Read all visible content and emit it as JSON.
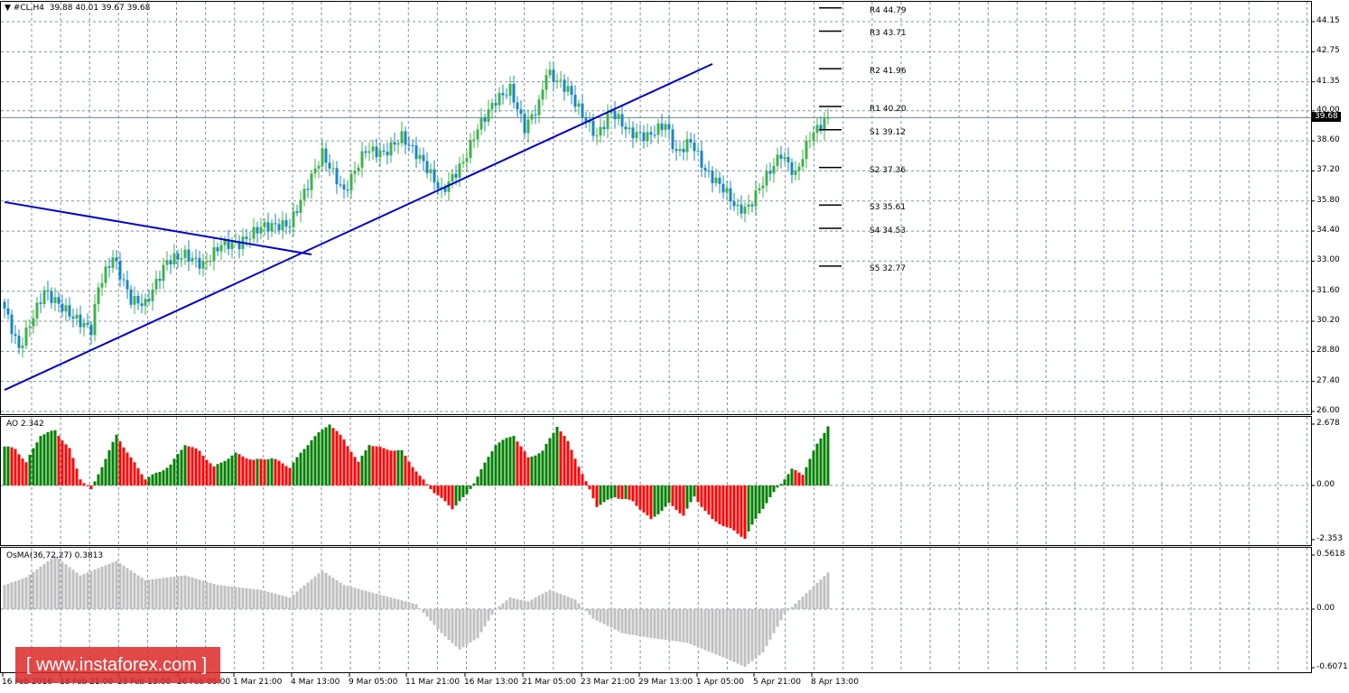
{
  "header": {
    "symbol": "#CL,H4",
    "ohlc": "39.88 40.01 39.67 39.68"
  },
  "current_price": "39.68",
  "watermark": "[ www.instaforex.com ]",
  "colors": {
    "bull": "#3fb24a",
    "bear": "#1a86c6",
    "ao_up": "#008000",
    "ao_down": "#ff0000",
    "osma": "#c0c0c0",
    "trendline": "#0000cc"
  },
  "pivots": [
    {
      "label": "R4 44.79",
      "value": 44.79
    },
    {
      "label": "R3 43.71",
      "value": 43.71
    },
    {
      "label": "R2 41.96",
      "value": 41.96
    },
    {
      "label": "R1 40.20",
      "value": 40.2
    },
    {
      "label": "S1 39.12",
      "value": 39.12
    },
    {
      "label": "S2 37.36",
      "value": 37.36
    },
    {
      "label": "S3 35.61",
      "value": 35.61
    },
    {
      "label": "S4 34.53",
      "value": 34.53
    },
    {
      "label": "S5 32.77",
      "value": 32.77
    }
  ],
  "chart_data": [
    {
      "type": "candlestick",
      "title": "#CL,H4",
      "yticks": [
        "44.15",
        "42.75",
        "41.35",
        "40.00",
        "38.60",
        "37.20",
        "35.80",
        "34.40",
        "33.00",
        "31.60",
        "30.20",
        "28.80",
        "27.40",
        "26.00"
      ],
      "ylim": [
        26.0,
        44.15
      ],
      "xticks": [
        "16 Feb 2016",
        "18 Feb 21:00",
        "23 Feb 13:00",
        "26 Feb 05:00",
        "1 Mar 21:00",
        "4 Mar 13:00",
        "9 Mar 05:00",
        "11 Mar 21:00",
        "16 Mar 13:00",
        "21 Mar 05:00",
        "23 Mar 21:00",
        "29 Mar 13:00",
        "1 Apr 05:00",
        "5 Apr 21:00",
        "8 Apr 13:00"
      ],
      "close_path": [
        [
          0,
          30.8
        ],
        [
          4,
          28.9
        ],
        [
          11,
          31.6
        ],
        [
          19,
          30.4
        ],
        [
          24,
          29.8
        ],
        [
          26,
          31.8
        ],
        [
          30,
          33.2
        ],
        [
          35,
          31.2
        ],
        [
          39,
          31.0
        ],
        [
          45,
          33.0
        ],
        [
          50,
          33.3
        ],
        [
          55,
          32.8
        ],
        [
          60,
          33.8
        ],
        [
          65,
          33.8
        ],
        [
          71,
          34.6
        ],
        [
          79,
          34.7
        ],
        [
          83,
          36.2
        ],
        [
          88,
          38.0
        ],
        [
          94,
          36.2
        ],
        [
          100,
          38.2
        ],
        [
          105,
          38.0
        ],
        [
          110,
          38.8
        ],
        [
          116,
          37.6
        ],
        [
          121,
          36.2
        ],
        [
          127,
          37.6
        ],
        [
          131,
          39.2
        ],
        [
          136,
          40.5
        ],
        [
          140,
          41.0
        ],
        [
          144,
          39.2
        ],
        [
          148,
          40.3
        ],
        [
          150,
          41.8
        ],
        [
          156,
          41.0
        ],
        [
          160,
          39.8
        ],
        [
          164,
          38.8
        ],
        [
          168,
          40.0
        ],
        [
          173,
          39.0
        ],
        [
          178,
          38.8
        ],
        [
          183,
          39.4
        ],
        [
          186,
          38.0
        ],
        [
          190,
          38.6
        ],
        [
          194,
          37.2
        ],
        [
          199,
          36.4
        ],
        [
          203,
          35.4
        ],
        [
          206,
          35.5
        ],
        [
          210,
          36.7
        ],
        [
          215,
          38.0
        ],
        [
          219,
          37.0
        ],
        [
          223,
          38.8
        ],
        [
          228,
          39.68
        ]
      ],
      "trendlines": [
        {
          "from": [
            0,
            27.0
          ],
          "to": [
            196,
            42.18
          ]
        },
        {
          "from": [
            0,
            35.75
          ],
          "to": [
            85,
            33.31
          ]
        }
      ]
    },
    {
      "type": "bar",
      "title": "AO 2.342",
      "yticks": [
        "2.678",
        "0.00",
        "-2.353"
      ],
      "ylim": [
        -2.353,
        2.678
      ],
      "path": [
        [
          0,
          1.7
        ],
        [
          3,
          1.6
        ],
        [
          6,
          1.0
        ],
        [
          10,
          2.2
        ],
        [
          14,
          2.4
        ],
        [
          18,
          1.6
        ],
        [
          21,
          0.3
        ],
        [
          24,
          -0.2
        ],
        [
          26,
          0.5
        ],
        [
          31,
          2.2
        ],
        [
          35,
          1.2
        ],
        [
          39,
          0.3
        ],
        [
          43,
          0.6
        ],
        [
          46,
          0.9
        ],
        [
          50,
          1.8
        ],
        [
          54,
          1.5
        ],
        [
          58,
          0.8
        ],
        [
          64,
          1.4
        ],
        [
          69,
          1.1
        ],
        [
          74,
          1.2
        ],
        [
          79,
          0.8
        ],
        [
          85,
          2.0
        ],
        [
          90,
          2.7
        ],
        [
          94,
          2.0
        ],
        [
          98,
          1.0
        ],
        [
          101,
          1.8
        ],
        [
          105,
          1.6
        ],
        [
          110,
          1.5
        ],
        [
          115,
          0.4
        ],
        [
          119,
          -0.3
        ],
        [
          124,
          -1.0
        ],
        [
          128,
          -0.4
        ],
        [
          131,
          0.4
        ],
        [
          136,
          1.8
        ],
        [
          141,
          2.2
        ],
        [
          145,
          1.2
        ],
        [
          149,
          1.5
        ],
        [
          153,
          2.6
        ],
        [
          156,
          1.9
        ],
        [
          160,
          0.5
        ],
        [
          164,
          -0.9
        ],
        [
          169,
          -0.5
        ],
        [
          174,
          -0.7
        ],
        [
          179,
          -1.5
        ],
        [
          184,
          -0.8
        ],
        [
          188,
          -1.3
        ],
        [
          191,
          -0.5
        ],
        [
          196,
          -1.5
        ],
        [
          201,
          -1.9
        ],
        [
          205,
          -2.3
        ],
        [
          209,
          -1.2
        ],
        [
          214,
          -0.1
        ],
        [
          218,
          0.7
        ],
        [
          221,
          0.5
        ],
        [
          225,
          1.8
        ],
        [
          228,
          2.6
        ]
      ]
    },
    {
      "type": "bar",
      "title": "OsMA(36,72,27) 0.3813",
      "yticks": [
        "0.5618",
        "0.00",
        "-0.6071"
      ],
      "ylim": [
        -0.6071,
        0.5618
      ],
      "path": [
        [
          0,
          0.25
        ],
        [
          6,
          0.33
        ],
        [
          14,
          0.55
        ],
        [
          21,
          0.35
        ],
        [
          31,
          0.5
        ],
        [
          39,
          0.3
        ],
        [
          50,
          0.35
        ],
        [
          59,
          0.25
        ],
        [
          71,
          0.2
        ],
        [
          79,
          0.12
        ],
        [
          88,
          0.4
        ],
        [
          94,
          0.25
        ],
        [
          104,
          0.15
        ],
        [
          114,
          0.05
        ],
        [
          121,
          -0.25
        ],
        [
          126,
          -0.42
        ],
        [
          131,
          -0.3
        ],
        [
          136,
          0.0
        ],
        [
          140,
          0.12
        ],
        [
          145,
          0.08
        ],
        [
          151,
          0.2
        ],
        [
          158,
          0.1
        ],
        [
          163,
          -0.1
        ],
        [
          171,
          -0.25
        ],
        [
          179,
          -0.3
        ],
        [
          189,
          -0.35
        ],
        [
          199,
          -0.5
        ],
        [
          205,
          -0.6
        ],
        [
          210,
          -0.45
        ],
        [
          216,
          -0.05
        ],
        [
          223,
          0.2
        ],
        [
          228,
          0.38
        ]
      ]
    }
  ]
}
